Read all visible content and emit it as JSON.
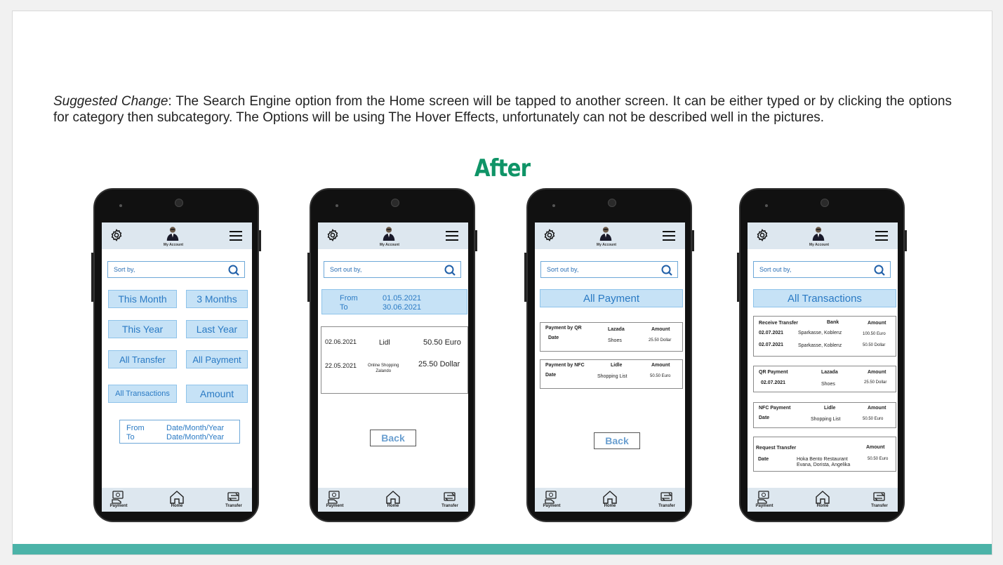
{
  "description": {
    "lead": "Suggested Change",
    "body": ": The Search Engine option from the Home screen will be tapped to another screen. It can be either typed or by clicking the options for category then subcategory. The Options will be using The Hover Effects, unfortunately can not be described well in the pictures."
  },
  "heading": "After",
  "common": {
    "account_label": "My Account",
    "nav": {
      "payment": "Payment",
      "home": "Home",
      "transfer": "Transfer"
    },
    "back_label": "Back"
  },
  "phone1": {
    "search_placeholder": "Sort by,",
    "buttons": [
      "This Month",
      "3 Months",
      "This Year",
      "Last Year",
      "All Transfer",
      "All Payment",
      "All Transactions",
      "Amount"
    ],
    "from_label": "From",
    "to_label": "To",
    "from_value": "Date/Month/Year",
    "to_value": "Date/Month/Year"
  },
  "phone2": {
    "search_placeholder": "Sort out by,",
    "from_label": "From",
    "to_label": "To",
    "from_value": "01.05.2021",
    "to_value": "30.06.2021",
    "rows": [
      {
        "date": "02.06.2021",
        "merchant": "Lidl",
        "amount": "50.50 Euro"
      },
      {
        "date": "22.05.2021",
        "merchant": "Online Shopping\nZalando",
        "amount": "25.50 Dollar"
      }
    ]
  },
  "phone3": {
    "search_placeholder": "Sort out by,",
    "title": "All Payment",
    "cards": [
      {
        "type": "Payment by QR",
        "sub": "Date",
        "merchant": "Lazada",
        "item": "Shoes",
        "amount_label": "Amount",
        "amount": "25.50 Dollar"
      },
      {
        "type": "Payment by NFC",
        "sub": "Date",
        "merchant": "Lidle",
        "item": "Shopping List",
        "amount_label": "Amount",
        "amount": "50.50 Euro"
      }
    ]
  },
  "phone4": {
    "search_placeholder": "Sort out by,",
    "title": "All Transactions",
    "card1": {
      "type": "Receive Transfer",
      "col": "Bank",
      "amount_label": "Amount",
      "rows": [
        {
          "date": "02.07.2021",
          "bank": "Sparkasse, Koblenz",
          "amount": "100.50 Euro"
        },
        {
          "date": "02.07.2021",
          "bank": "Sparkasse, Koblenz",
          "amount": "50.50 Dollar"
        }
      ]
    },
    "card2": {
      "type": "QR Payment",
      "merchant": "Lazada",
      "amount_label": "Amount",
      "date": "02.07.2021",
      "item": "Shoes",
      "amount": "25.50 Dollar"
    },
    "card3": {
      "type": "NFC Payment",
      "merchant": "Lidle",
      "amount_label": "Amount",
      "date": "Date",
      "item": "Shopping List",
      "amount": "50.50 Euro"
    },
    "card4": {
      "type": "Request Transfer",
      "amount_label": "Amount",
      "date": "Date",
      "line1": "Hoka Bento Restaurant",
      "line2": "Evana, Dorista, Angelika",
      "amount": "50.50 Euro"
    }
  }
}
